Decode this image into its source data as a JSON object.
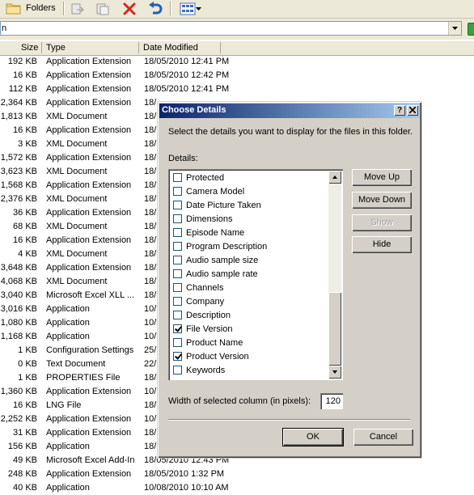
{
  "toolbar": {
    "folders_label": "Folders"
  },
  "address": {
    "value": "n"
  },
  "columns": {
    "size": "Size",
    "type": "Type",
    "date": "Date Modified"
  },
  "files": [
    {
      "size": "192 KB",
      "type": "Application Extension",
      "date": "18/05/2010 12:41 PM"
    },
    {
      "size": "16 KB",
      "type": "Application Extension",
      "date": "18/05/2010 12:42 PM"
    },
    {
      "size": "112 KB",
      "type": "Application Extension",
      "date": "18/05/2010 12:41 PM"
    },
    {
      "size": "2,364 KB",
      "type": "Application Extension",
      "date": "18/"
    },
    {
      "size": "1,813 KB",
      "type": "XML Document",
      "date": "18/"
    },
    {
      "size": "16 KB",
      "type": "Application Extension",
      "date": "18/"
    },
    {
      "size": "3 KB",
      "type": "XML Document",
      "date": "18/"
    },
    {
      "size": "1,572 KB",
      "type": "Application Extension",
      "date": "18/"
    },
    {
      "size": "3,623 KB",
      "type": "XML Document",
      "date": "18/"
    },
    {
      "size": "1,568 KB",
      "type": "Application Extension",
      "date": "18/"
    },
    {
      "size": "2,376 KB",
      "type": "XML Document",
      "date": "18/"
    },
    {
      "size": "36 KB",
      "type": "Application Extension",
      "date": "18/"
    },
    {
      "size": "68 KB",
      "type": "XML Document",
      "date": "18/"
    },
    {
      "size": "16 KB",
      "type": "Application Extension",
      "date": "18/"
    },
    {
      "size": "4 KB",
      "type": "XML Document",
      "date": "18/"
    },
    {
      "size": "3,648 KB",
      "type": "Application Extension",
      "date": "18/"
    },
    {
      "size": "4,068 KB",
      "type": "XML Document",
      "date": "18/"
    },
    {
      "size": "3,040 KB",
      "type": "Microsoft Excel XLL ...",
      "date": "18/"
    },
    {
      "size": "3,016 KB",
      "type": "Application",
      "date": "10/"
    },
    {
      "size": "1,080 KB",
      "type": "Application",
      "date": "10/"
    },
    {
      "size": "1,168 KB",
      "type": "Application",
      "date": "10/"
    },
    {
      "size": "1 KB",
      "type": "Configuration Settings",
      "date": "25/"
    },
    {
      "size": "0 KB",
      "type": "Text Document",
      "date": "22/"
    },
    {
      "size": "1 KB",
      "type": "PROPERTIES File",
      "date": "18/"
    },
    {
      "size": "1,360 KB",
      "type": "Application Extension",
      "date": "10/"
    },
    {
      "size": "16 KB",
      "type": "LNG File",
      "date": "18/"
    },
    {
      "size": "2,252 KB",
      "type": "Application Extension",
      "date": "10/"
    },
    {
      "size": "31 KB",
      "type": "Application Extension",
      "date": "18/"
    },
    {
      "size": "156 KB",
      "type": "Application",
      "date": "18/"
    },
    {
      "size": "49 KB",
      "type": "Microsoft Excel Add-In",
      "date": "18/05/2010 12:43 PM"
    },
    {
      "size": "248 KB",
      "type": "Application Extension",
      "date": "18/05/2010 1:32 PM"
    },
    {
      "size": "40 KB",
      "type": "Application",
      "date": "10/08/2010 10:10 AM"
    }
  ],
  "dialog": {
    "title": "Choose Details",
    "help_glyph": "?",
    "description": "Select the details you want to display for the files in this folder.",
    "details_label": "Details:",
    "items": [
      {
        "label": "Protected",
        "checked": false
      },
      {
        "label": "Camera Model",
        "checked": false
      },
      {
        "label": "Date Picture Taken",
        "checked": false
      },
      {
        "label": "Dimensions",
        "checked": false
      },
      {
        "label": "Episode Name",
        "checked": false
      },
      {
        "label": "Program Description",
        "checked": false
      },
      {
        "label": "Audio sample size",
        "checked": false
      },
      {
        "label": "Audio sample rate",
        "checked": false
      },
      {
        "label": "Channels",
        "checked": false
      },
      {
        "label": "Company",
        "checked": false
      },
      {
        "label": "Description",
        "checked": false
      },
      {
        "label": "File Version",
        "checked": true
      },
      {
        "label": "Product Name",
        "checked": false
      },
      {
        "label": "Product Version",
        "checked": true
      },
      {
        "label": "Keywords",
        "checked": false
      }
    ],
    "buttons": {
      "move_up": "Move Up",
      "move_down": "Move Down",
      "show": "Show",
      "hide": "Hide",
      "ok": "OK",
      "cancel": "Cancel"
    },
    "width_label": "Width of selected column (in pixels):",
    "width_value": "120"
  }
}
